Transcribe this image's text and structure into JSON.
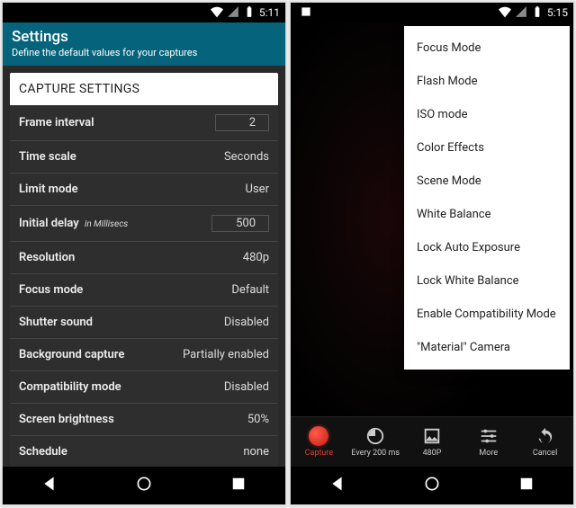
{
  "left": {
    "status": {
      "time": "5:11"
    },
    "header": {
      "title": "Settings",
      "subtitle": "Define the default values for your captures"
    },
    "section_header": "CAPTURE SETTINGS",
    "rows": [
      {
        "label": "Frame interval",
        "value": "2",
        "boxed": true
      },
      {
        "label": "Time scale",
        "value": "Seconds"
      },
      {
        "label": "Limit mode",
        "value": "User"
      },
      {
        "label": "Initial delay",
        "hint": "in Millisecs",
        "value": "500",
        "boxed": true
      },
      {
        "label": "Resolution",
        "value": "480p"
      },
      {
        "label": "Focus mode",
        "value": "Default"
      },
      {
        "label": "Shutter sound",
        "value": "Disabled"
      },
      {
        "label": "Background capture",
        "value": "Partially enabled"
      },
      {
        "label": "Compatibility mode",
        "value": "Disabled"
      },
      {
        "label": "Screen brightness",
        "value": "50%"
      },
      {
        "label": "Schedule",
        "value": "none"
      }
    ]
  },
  "right": {
    "status": {
      "time": "5:15"
    },
    "menu": [
      "Focus Mode",
      "Flash Mode",
      "ISO mode",
      "Color Effects",
      "Scene Mode",
      "White Balance",
      "Lock Auto Exposure",
      "Lock White Balance",
      "Enable Compatibility Mode",
      "\"Material\" Camera"
    ],
    "toolbar": [
      {
        "name": "capture",
        "label": "Capture",
        "icon": "record",
        "active": true
      },
      {
        "name": "interval",
        "label": "Every 200 ms",
        "icon": "timer"
      },
      {
        "name": "res",
        "label": "480P",
        "icon": "image"
      },
      {
        "name": "more",
        "label": "More",
        "icon": "sliders"
      },
      {
        "name": "cancel",
        "label": "Cancel",
        "icon": "undo"
      }
    ]
  }
}
